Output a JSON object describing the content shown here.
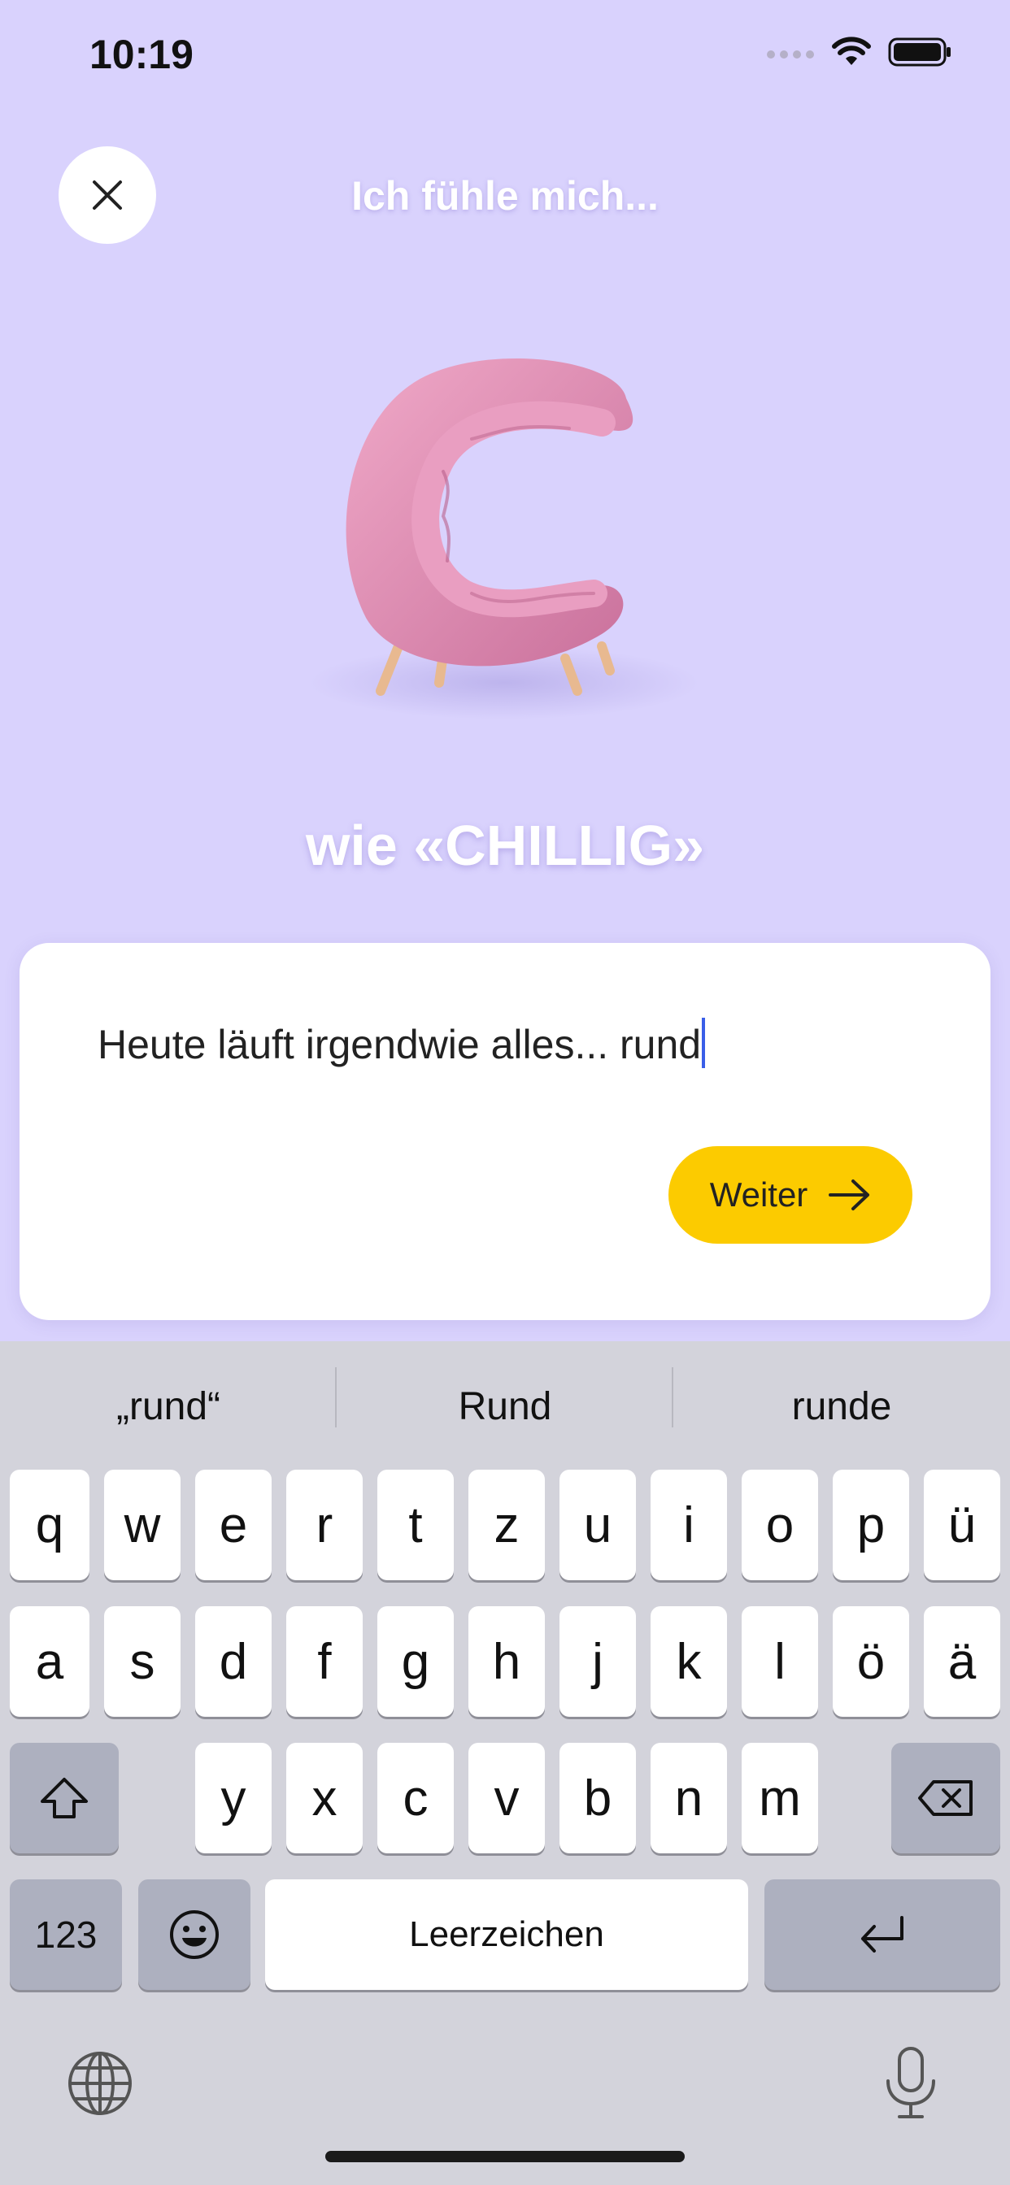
{
  "status_bar": {
    "time": "10:19"
  },
  "header": {
    "title": "Ich fühle mich..."
  },
  "mood": {
    "label": "wie «CHILLIG»"
  },
  "entry": {
    "text": "Heute läuft irgendwie alles... rund"
  },
  "next_button": {
    "label": "Weiter"
  },
  "keyboard": {
    "suggestions": [
      "„rund“",
      "Rund",
      "runde"
    ],
    "row1": [
      "q",
      "w",
      "e",
      "r",
      "t",
      "z",
      "u",
      "i",
      "o",
      "p",
      "ü"
    ],
    "row2": [
      "a",
      "s",
      "d",
      "f",
      "g",
      "h",
      "j",
      "k",
      "l",
      "ö",
      "ä"
    ],
    "row3": [
      "y",
      "x",
      "c",
      "v",
      "b",
      "n",
      "m"
    ],
    "numbers_label": "123",
    "space_label": "Leerzeichen"
  },
  "colors": {
    "background": "#d9d2fd",
    "accent": "#fccb00",
    "caret": "#3a5ee8",
    "chair": "#e28fb5"
  },
  "icons": [
    "close-icon",
    "arrow-right-icon",
    "shift-icon",
    "backspace-icon",
    "emoji-icon",
    "return-icon",
    "globe-icon",
    "microphone-icon",
    "wifi-icon",
    "battery-icon",
    "cellular-icon"
  ]
}
